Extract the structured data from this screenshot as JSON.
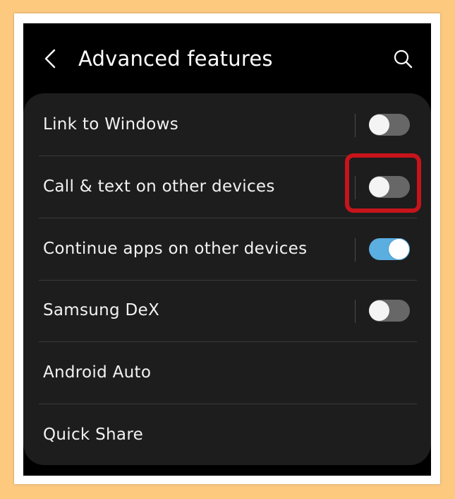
{
  "header": {
    "title": "Advanced features",
    "back_icon": "chevron-left-icon",
    "search_icon": "search-icon"
  },
  "settings": [
    {
      "label": "Link to Windows",
      "has_toggle": true,
      "toggle_on": false
    },
    {
      "label": "Call & text on other devices",
      "has_toggle": true,
      "toggle_on": false
    },
    {
      "label": "Continue apps on other devices",
      "has_toggle": true,
      "toggle_on": true
    },
    {
      "label": "Samsung DeX",
      "has_toggle": true,
      "toggle_on": false
    },
    {
      "label": "Android Auto",
      "has_toggle": false
    },
    {
      "label": "Quick Share",
      "has_toggle": false
    }
  ],
  "colors": {
    "background": "#fcc97f",
    "screen": "#000000",
    "card": "#1d1d1d",
    "toggle_on": "#5aaee0",
    "toggle_off": "#676767",
    "highlight": "#c7141b"
  }
}
